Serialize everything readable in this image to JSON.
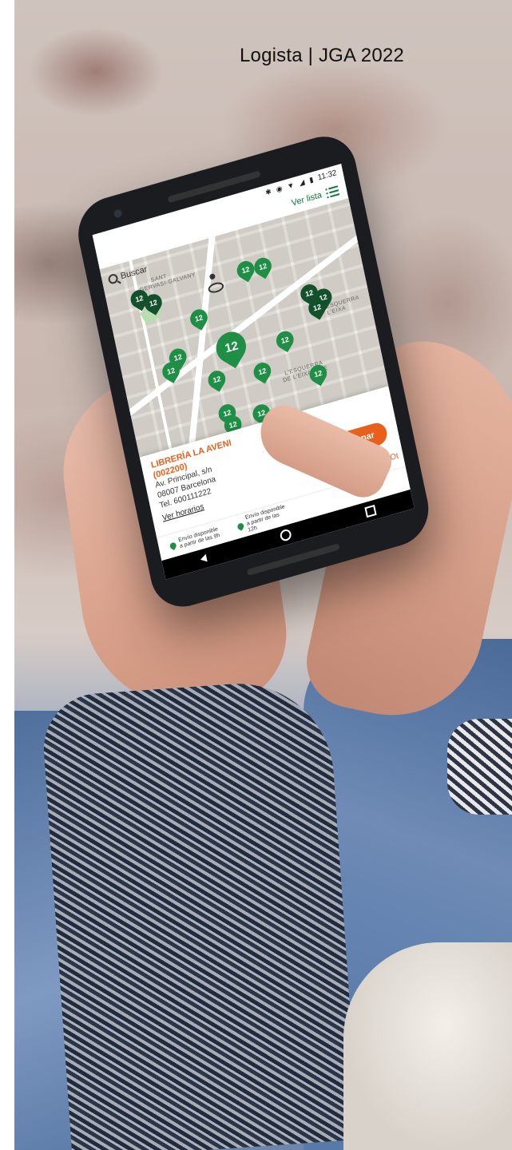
{
  "caption": "Logista | JGA 2022",
  "phone": {
    "status_time": "11:32",
    "view_list_label": "Ver lista",
    "search_placeholder": "Buscar",
    "map_labels": [
      "SANT",
      "GERVASI-GALVANY",
      "L'ESQUERRA",
      "DE L'EIXAMPLE",
      "ESQUERRA",
      "L'EIXA"
    ],
    "pin_label": "12",
    "card": {
      "title": "LIBRERÍA LA AVENI",
      "code": "(002200)",
      "address": "Av. Principal, s/n",
      "city": "08007 Barcelona",
      "phone": "Tel. 600111222",
      "hours_link": "Ver horarios",
      "select_button": "Seleccionar",
      "right_link": "Ot"
    },
    "legend": [
      {
        "text": "Envío disponible a partir de las 9h"
      },
      {
        "text": "Envío disponible a partir de las 12h"
      }
    ]
  },
  "colors": {
    "accent_orange": "#e8601c",
    "pin_green": "#1f8f45",
    "pin_dark": "#13502c"
  }
}
